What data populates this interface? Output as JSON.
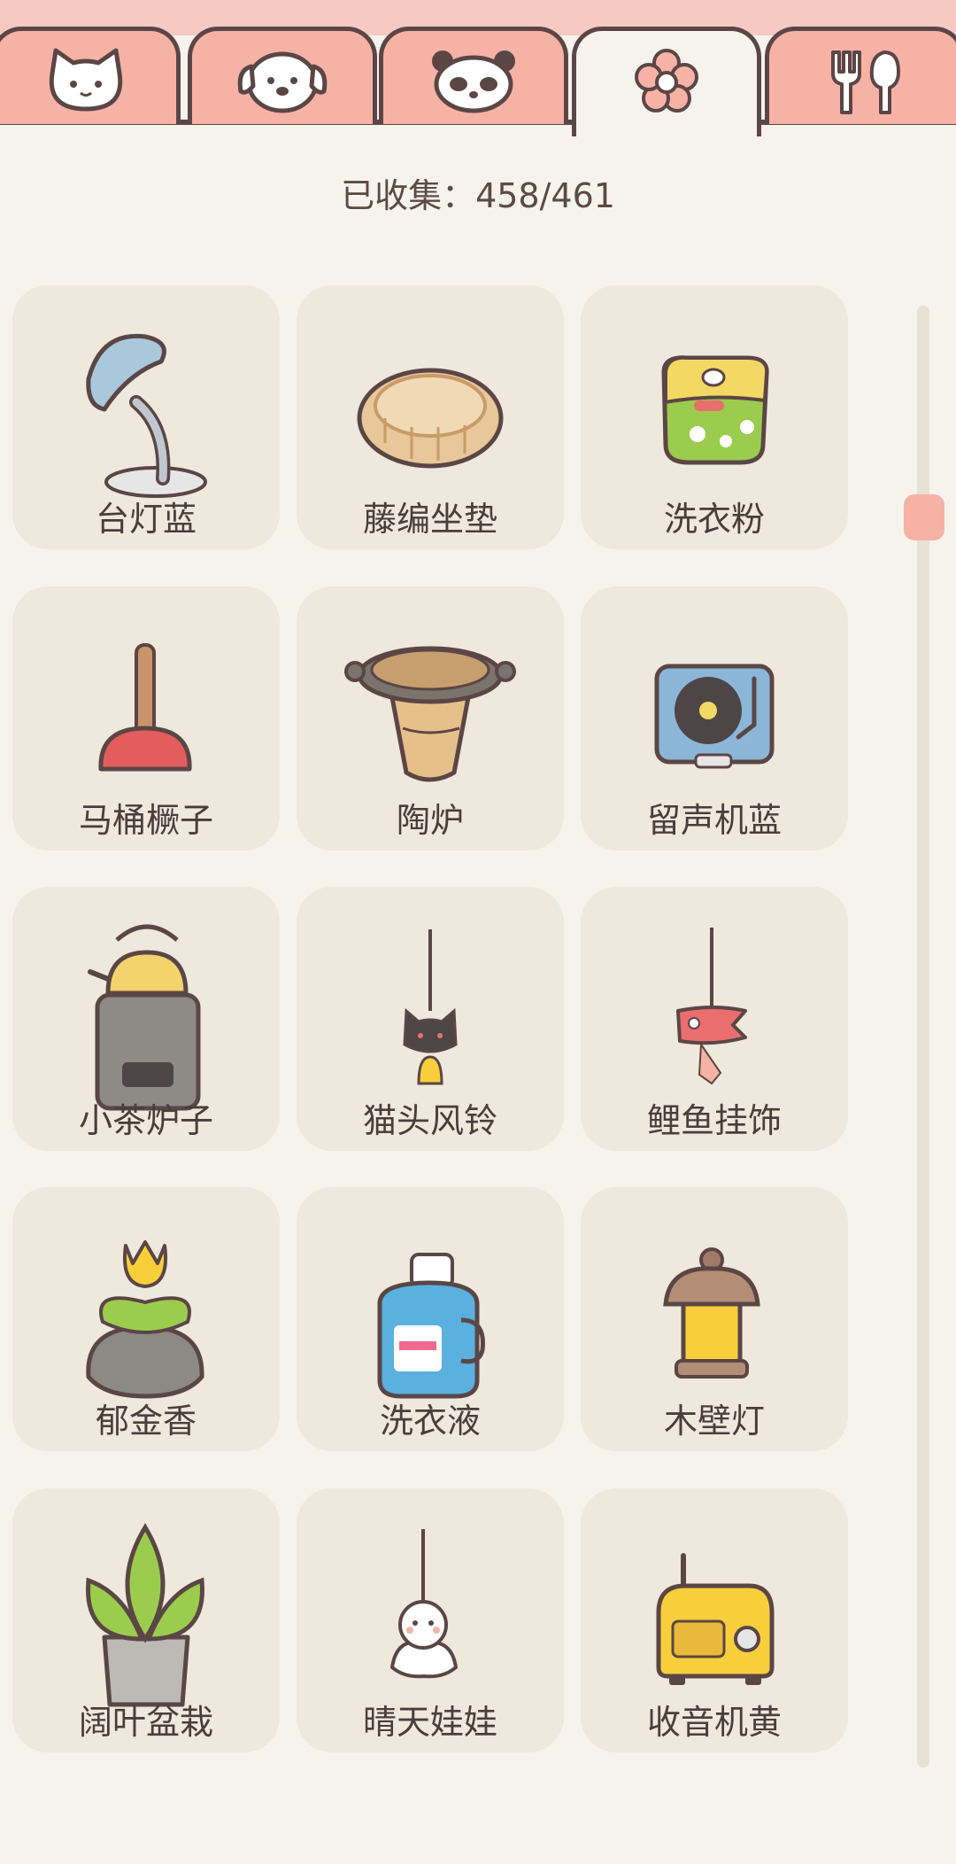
{
  "tabs": [
    {
      "name": "cat-icon",
      "active": false
    },
    {
      "name": "dog-icon",
      "active": false
    },
    {
      "name": "panda-icon",
      "active": false
    },
    {
      "name": "flower-icon",
      "active": true
    },
    {
      "name": "fork-spoon-icon",
      "active": false
    }
  ],
  "colors": {
    "background": "#f6f3ec",
    "tab": "#f7b2a6",
    "card": "#efe8dc",
    "outline": "#5b4646",
    "scroll_thumb": "#f7b2a6"
  },
  "collection": {
    "counter_text": "已收集：458/461"
  },
  "items": [
    {
      "label": "台灯蓝",
      "icon": "desk-lamp-icon"
    },
    {
      "label": "藤编坐垫",
      "icon": "rattan-cushion-icon"
    },
    {
      "label": "洗衣粉",
      "icon": "detergent-powder-icon"
    },
    {
      "label": "马桶橛子",
      "icon": "plunger-icon"
    },
    {
      "label": "陶炉",
      "icon": "clay-stove-icon"
    },
    {
      "label": "留声机蓝",
      "icon": "record-player-icon"
    },
    {
      "label": "小茶炉子",
      "icon": "tea-stove-icon"
    },
    {
      "label": "猫头风铃",
      "icon": "cat-wind-chime-icon"
    },
    {
      "label": "鲤鱼挂饰",
      "icon": "koi-ornament-icon"
    },
    {
      "label": "郁金香",
      "icon": "tulip-icon"
    },
    {
      "label": "洗衣液",
      "icon": "laundry-liquid-icon"
    },
    {
      "label": "木壁灯",
      "icon": "wooden-lamp-icon"
    },
    {
      "label": "阔叶盆栽",
      "icon": "potted-plant-icon"
    },
    {
      "label": "晴天娃娃",
      "icon": "teru-teru-bozu-icon"
    },
    {
      "label": "收音机黄",
      "icon": "radio-icon"
    }
  ]
}
